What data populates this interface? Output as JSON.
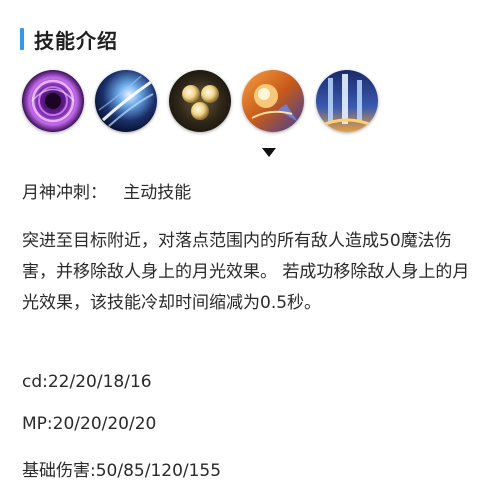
{
  "section": {
    "title": "技能介绍"
  },
  "skills": [
    {
      "name": "skill-1",
      "icon": "purple-vortex-icon"
    },
    {
      "name": "skill-2",
      "icon": "blue-slash-icon"
    },
    {
      "name": "skill-3",
      "icon": "golden-orbs-icon"
    },
    {
      "name": "skill-4",
      "icon": "orange-burst-icon"
    },
    {
      "name": "skill-5",
      "icon": "blue-pillars-icon"
    }
  ],
  "selected_skill": {
    "name_label": "月神冲刺：",
    "type_label": "主动技能",
    "description": "突进至目标附近，对落点范围内的所有敌人造成50魔法伤害，并移除敌人身上的月光效果。 若成功移除敌人身上的月光效果，该技能冷却时间缩减为0.5秒。",
    "cooldown": "cd:22/20/18/16",
    "mana": "MP:20/20/20/20",
    "base_damage": "基础伤害:50/85/120/155"
  },
  "colors": {
    "accent": "#2f9bf0"
  }
}
